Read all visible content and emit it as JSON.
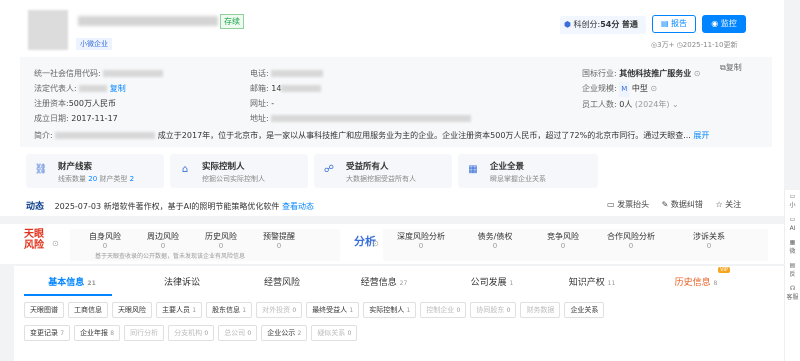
{
  "header": {
    "status": "存续",
    "tag": "小微企业",
    "score_label": "科创分:",
    "score_value": "54分",
    "score_level": "普通",
    "btn_report": "报告",
    "btn_monitor": "监控",
    "views": "3万+",
    "updated": "2025-11-10更新"
  },
  "info": {
    "credit_code_label": "统一社会信用代码:",
    "legal_rep_label": "法定代表人:",
    "copy": "复制",
    "capital_label": "注册资本:",
    "capital": "500万人民币",
    "founded_label": "成立日期:",
    "founded": "2017-11-17",
    "phone_label": "电话:",
    "email_label": "邮箱:",
    "email_prefix": "14",
    "website_label": "网址:",
    "website": "-",
    "address_label": "地址:",
    "industry_label": "国标行业:",
    "industry": "其他科技推广服务业",
    "copy2": "复制",
    "scale_label": "企业规模:",
    "scale_badge": "M",
    "scale": "中型",
    "staff_label": "员工人数:",
    "staff": "0人",
    "staff_year": "(2024年)",
    "intro_label": "简介:",
    "intro": "成立于2017年，位于北京市，是一家以从事科技推广和应用服务业为主的企业。企业注册资本500万人民币，超过了72%的北京市同行。通过天眼查...",
    "intro_more": "展开"
  },
  "features": [
    {
      "icon": "⛓",
      "title": "财产线索",
      "sub1": "线索数量",
      "n1": "20",
      "sub2": "财产类型",
      "n2": "2"
    },
    {
      "icon": "⌂",
      "title": "实际控制人",
      "sub1": "挖掘公司实际控制人"
    },
    {
      "icon": "☍",
      "title": "受益所有人",
      "sub1": "大数据挖掘受益所有人"
    },
    {
      "icon": "▦",
      "title": "企业全景",
      "sub1": "瞬息掌握企业关系"
    }
  ],
  "dynamic": {
    "label": "动态",
    "text": "2025-07-03 新增软件著作权，基于AI的照明节能策略优化软件",
    "link": "查看动态",
    "invoice": "发票抬头",
    "correct": "数据纠错",
    "follow": "关注"
  },
  "risk": {
    "brand1": "天眼",
    "brand2": "风险",
    "items": [
      {
        "label": "自身风险",
        "value": "0"
      },
      {
        "label": "周边风险",
        "value": "0"
      },
      {
        "label": "历史风险",
        "value": "0"
      },
      {
        "label": "预警提醒",
        "value": "0"
      }
    ],
    "note": "基于天眼查收录的公开数据，暂未发现该企业有风险信息",
    "analysis": "分析",
    "analysis_items": [
      {
        "label": "深度风险分析",
        "value": "0"
      },
      {
        "label": "债务/债权",
        "value": "0"
      },
      {
        "label": "竞争风险",
        "value": "0"
      },
      {
        "label": "合作风险分析",
        "value": "0"
      },
      {
        "label": "涉诉关系",
        "value": "0"
      }
    ]
  },
  "tabs": [
    {
      "label": "基本信息",
      "count": "21"
    },
    {
      "label": "法律诉讼",
      "count": ""
    },
    {
      "label": "经营风险",
      "count": ""
    },
    {
      "label": "经营信息",
      "count": "27"
    },
    {
      "label": "公司发展",
      "count": "1"
    },
    {
      "label": "知识产权",
      "count": "11"
    },
    {
      "label": "历史信息",
      "count": "8",
      "badge": "VIP"
    }
  ],
  "chips_row1": [
    {
      "label": "天眼图谱",
      "count": ""
    },
    {
      "label": "工商信息",
      "count": ""
    },
    {
      "label": "天眼风险",
      "count": ""
    },
    {
      "label": "主要人员",
      "count": "1"
    },
    {
      "label": "股东信息",
      "count": "1"
    },
    {
      "label": "对外投资",
      "count": "0",
      "dis": true
    },
    {
      "label": "最终受益人",
      "count": "1"
    },
    {
      "label": "实际控制人",
      "count": "1"
    },
    {
      "label": "控制企业",
      "count": "0",
      "dis": true
    },
    {
      "label": "协同股东",
      "count": "0",
      "dis": true
    },
    {
      "label": "财务数据",
      "count": "",
      "dis": true
    },
    {
      "label": "企业关系",
      "count": ""
    }
  ],
  "chips_row2": [
    {
      "label": "变更记录",
      "count": "7"
    },
    {
      "label": "企业年报",
      "count": "8"
    },
    {
      "label": "同行分析",
      "count": "",
      "dis": true
    },
    {
      "label": "分支机构",
      "count": "0",
      "dis": true
    },
    {
      "label": "总公司",
      "count": "0",
      "dis": true
    },
    {
      "label": "企业公示",
      "count": "2"
    },
    {
      "label": "疑似关系",
      "count": "0",
      "dis": true
    }
  ],
  "sidebar": {
    "a": "小",
    "b": "AI",
    "c": "微",
    "d": "反",
    "e": "客服"
  }
}
